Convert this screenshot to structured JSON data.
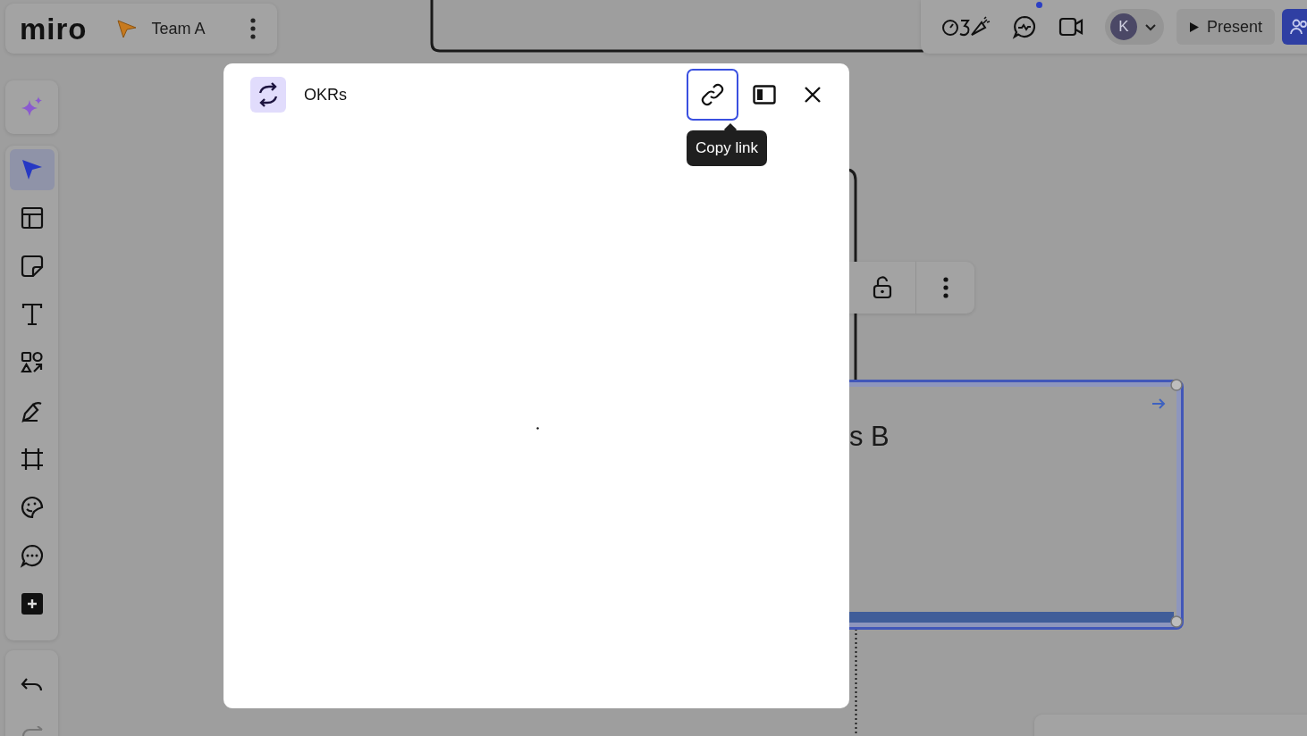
{
  "board_header": {
    "logo": "miro",
    "board_name": "Team A"
  },
  "top_bar": {
    "notification_dot": true,
    "avatar_initial": "K",
    "present_label": "Present"
  },
  "tools": [
    {
      "kind": "select",
      "selected": true
    },
    {
      "kind": "templates",
      "selected": false
    },
    {
      "kind": "sticky",
      "selected": false
    },
    {
      "kind": "text",
      "selected": false
    },
    {
      "kind": "shapes",
      "selected": false
    },
    {
      "kind": "pen",
      "selected": false
    },
    {
      "kind": "frame",
      "selected": false
    },
    {
      "kind": "stickers",
      "selected": false
    },
    {
      "kind": "comment",
      "selected": false
    },
    {
      "kind": "more",
      "selected": false
    }
  ],
  "canvas": {
    "shape_text": "s B",
    "shape_selected": true
  },
  "modal": {
    "title": "OKRs",
    "copy_link_focused": true,
    "tooltip": "Copy link"
  }
}
